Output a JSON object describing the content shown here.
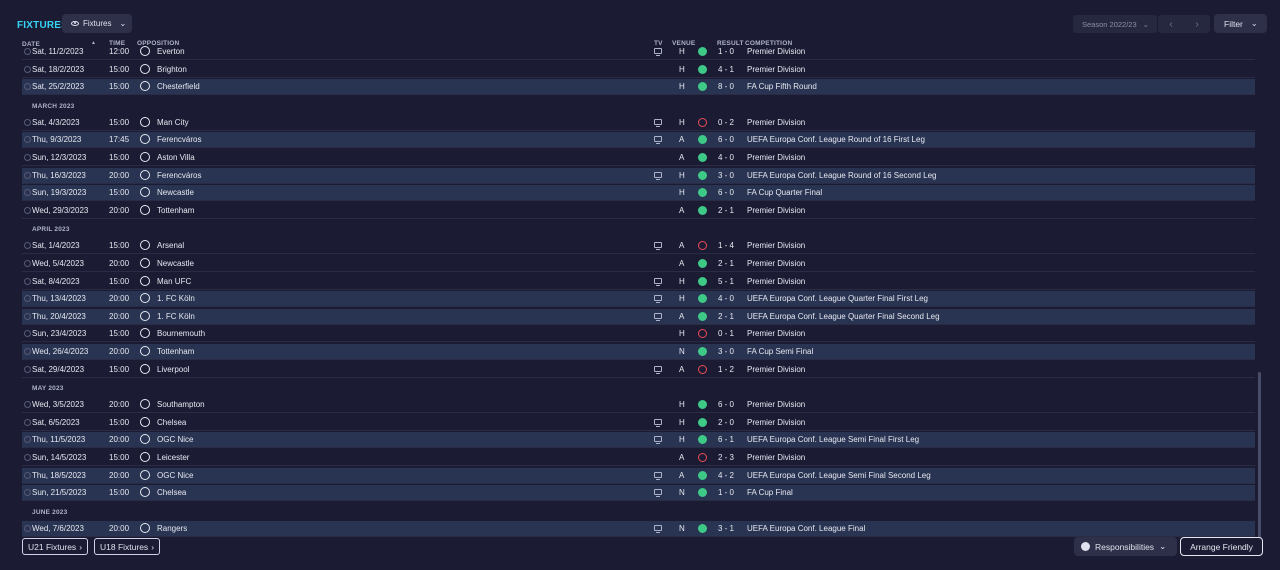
{
  "header": {
    "title": "FIXTURES",
    "view_label": "Fixtures",
    "season_label": "Season 2022/23",
    "filter_label": "Filter"
  },
  "columns": {
    "date": "DATE",
    "time": "TIME",
    "opposition": "OPPOSITION",
    "tv": "TV",
    "venue": "VENUE",
    "result": "RESULT",
    "competition": "COMPETITION"
  },
  "items": [
    {
      "kind": "row",
      "alt": false,
      "date": "Sat, 11/2/2023",
      "time": "12:00",
      "opp": "Everton",
      "tv": true,
      "venue": "H",
      "outcome": "win",
      "result": "1 - 0",
      "comp": "Premier Division"
    },
    {
      "kind": "row",
      "alt": false,
      "date": "Sat, 18/2/2023",
      "time": "15:00",
      "opp": "Brighton",
      "tv": false,
      "venue": "H",
      "outcome": "win",
      "result": "4 - 1",
      "comp": "Premier Division"
    },
    {
      "kind": "row",
      "alt": true,
      "date": "Sat, 25/2/2023",
      "time": "15:00",
      "opp": "Chesterfield",
      "tv": false,
      "venue": "H",
      "outcome": "win",
      "result": "8 - 0",
      "comp": "FA Cup Fifth Round"
    },
    {
      "kind": "month",
      "label": "MARCH 2023"
    },
    {
      "kind": "row",
      "alt": false,
      "date": "Sat, 4/3/2023",
      "time": "15:00",
      "opp": "Man City",
      "tv": true,
      "venue": "H",
      "outcome": "loss",
      "result": "0 - 2",
      "comp": "Premier Division"
    },
    {
      "kind": "row",
      "alt": true,
      "date": "Thu, 9/3/2023",
      "time": "17:45",
      "opp": "Ferencváros",
      "tv": true,
      "venue": "A",
      "outcome": "win",
      "result": "6 - 0",
      "comp": "UEFA Europa Conf. League Round of 16  First Leg"
    },
    {
      "kind": "row",
      "alt": false,
      "date": "Sun, 12/3/2023",
      "time": "15:00",
      "opp": "Aston Villa",
      "tv": false,
      "venue": "A",
      "outcome": "win",
      "result": "4 - 0",
      "comp": "Premier Division"
    },
    {
      "kind": "row",
      "alt": true,
      "date": "Thu, 16/3/2023",
      "time": "20:00",
      "opp": "Ferencváros",
      "tv": true,
      "venue": "H",
      "outcome": "win",
      "result": "3 - 0",
      "comp": "UEFA Europa Conf. League Round of 16  Second Leg"
    },
    {
      "kind": "row",
      "alt": true,
      "date": "Sun, 19/3/2023",
      "time": "15:00",
      "opp": "Newcastle",
      "tv": false,
      "venue": "H",
      "outcome": "win",
      "result": "6 - 0",
      "comp": "FA Cup Quarter Final"
    },
    {
      "kind": "row",
      "alt": false,
      "date": "Wed, 29/3/2023",
      "time": "20:00",
      "opp": "Tottenham",
      "tv": false,
      "venue": "A",
      "outcome": "win",
      "result": "2 - 1",
      "comp": "Premier Division"
    },
    {
      "kind": "month",
      "label": "APRIL 2023"
    },
    {
      "kind": "row",
      "alt": false,
      "date": "Sat, 1/4/2023",
      "time": "15:00",
      "opp": "Arsenal",
      "tv": true,
      "venue": "A",
      "outcome": "loss",
      "result": "1 - 4",
      "comp": "Premier Division"
    },
    {
      "kind": "row",
      "alt": false,
      "date": "Wed, 5/4/2023",
      "time": "20:00",
      "opp": "Newcastle",
      "tv": false,
      "venue": "A",
      "outcome": "win",
      "result": "2 - 1",
      "comp": "Premier Division"
    },
    {
      "kind": "row",
      "alt": false,
      "date": "Sat, 8/4/2023",
      "time": "15:00",
      "opp": "Man UFC",
      "tv": true,
      "venue": "H",
      "outcome": "win",
      "result": "5 - 1",
      "comp": "Premier Division"
    },
    {
      "kind": "row",
      "alt": true,
      "date": "Thu, 13/4/2023",
      "time": "20:00",
      "opp": "1. FC Köln",
      "tv": true,
      "venue": "H",
      "outcome": "win",
      "result": "4 - 0",
      "comp": "UEFA Europa Conf. League Quarter Final First Leg"
    },
    {
      "kind": "row",
      "alt": true,
      "date": "Thu, 20/4/2023",
      "time": "20:00",
      "opp": "1. FC Köln",
      "tv": true,
      "venue": "A",
      "outcome": "win",
      "result": "2 - 1",
      "comp": "UEFA Europa Conf. League Quarter Final Second Leg"
    },
    {
      "kind": "row",
      "alt": false,
      "date": "Sun, 23/4/2023",
      "time": "15:00",
      "opp": "Bournemouth",
      "tv": false,
      "venue": "H",
      "outcome": "loss",
      "result": "0 - 1",
      "comp": "Premier Division"
    },
    {
      "kind": "row",
      "alt": true,
      "date": "Wed, 26/4/2023",
      "time": "20:00",
      "opp": "Tottenham",
      "tv": false,
      "venue": "N",
      "outcome": "win",
      "result": "3 - 0",
      "comp": "FA Cup Semi Final"
    },
    {
      "kind": "row",
      "alt": false,
      "date": "Sat, 29/4/2023",
      "time": "15:00",
      "opp": "Liverpool",
      "tv": true,
      "venue": "A",
      "outcome": "loss",
      "result": "1 - 2",
      "comp": "Premier Division"
    },
    {
      "kind": "month",
      "label": "MAY 2023"
    },
    {
      "kind": "row",
      "alt": false,
      "date": "Wed, 3/5/2023",
      "time": "20:00",
      "opp": "Southampton",
      "tv": false,
      "venue": "H",
      "outcome": "win",
      "result": "6 - 0",
      "comp": "Premier Division"
    },
    {
      "kind": "row",
      "alt": false,
      "date": "Sat, 6/5/2023",
      "time": "15:00",
      "opp": "Chelsea",
      "tv": true,
      "venue": "H",
      "outcome": "win",
      "result": "2 - 0",
      "comp": "Premier Division"
    },
    {
      "kind": "row",
      "alt": true,
      "date": "Thu, 11/5/2023",
      "time": "20:00",
      "opp": "OGC Nice",
      "tv": true,
      "venue": "H",
      "outcome": "win",
      "result": "6 - 1",
      "comp": "UEFA Europa Conf. League Semi Final First Leg"
    },
    {
      "kind": "row",
      "alt": false,
      "date": "Sun, 14/5/2023",
      "time": "15:00",
      "opp": "Leicester",
      "tv": false,
      "venue": "A",
      "outcome": "loss",
      "result": "2 - 3",
      "comp": "Premier Division"
    },
    {
      "kind": "row",
      "alt": true,
      "date": "Thu, 18/5/2023",
      "time": "20:00",
      "opp": "OGC Nice",
      "tv": true,
      "venue": "A",
      "outcome": "win",
      "result": "4 - 2",
      "comp": "UEFA Europa Conf. League Semi Final Second Leg"
    },
    {
      "kind": "row",
      "alt": true,
      "date": "Sun, 21/5/2023",
      "time": "15:00",
      "opp": "Chelsea",
      "tv": true,
      "venue": "N",
      "outcome": "win",
      "result": "1 - 0",
      "comp": "FA Cup Final"
    },
    {
      "kind": "month",
      "label": "JUNE 2023"
    },
    {
      "kind": "row",
      "alt": true,
      "date": "Wed, 7/6/2023",
      "time": "20:00",
      "opp": "Rangers",
      "tv": true,
      "venue": "N",
      "outcome": "win",
      "result": "3 - 1",
      "comp": "UEFA Europa Conf. League Final"
    }
  ],
  "footer": {
    "u21_label": "U21 Fixtures",
    "u18_label": "U18 Fixtures",
    "responsibilities_label": "Responsibilities",
    "arrange_label": "Arrange Friendly"
  },
  "colors": {
    "accent": "#35d3f3",
    "win": "#3fc986",
    "loss": "#ea4d57",
    "row_highlight": "#293452"
  }
}
